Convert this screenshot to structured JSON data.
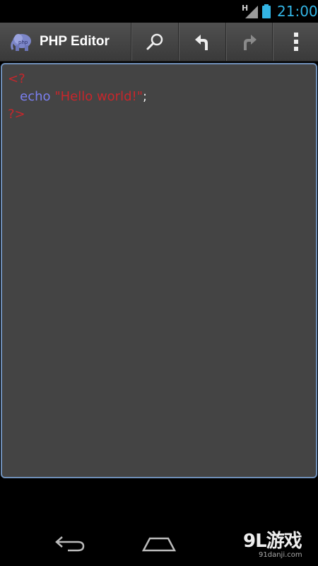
{
  "status_bar": {
    "network": "H",
    "time": "21:00",
    "time_color": "#33b5e5"
  },
  "action_bar": {
    "title": "PHP Editor",
    "actions": [
      {
        "icon": "search-icon"
      },
      {
        "icon": "undo-icon"
      },
      {
        "icon": "redo-icon"
      },
      {
        "icon": "overflow-menu-icon"
      }
    ]
  },
  "editor": {
    "border_color": "#6f8fb8",
    "background": "#444444",
    "lines": [
      {
        "tokens": [
          {
            "t": "tag",
            "text": "<?"
          }
        ]
      },
      {
        "tokens": [
          {
            "t": "ws",
            "text": "   "
          },
          {
            "t": "kw",
            "text": "echo"
          },
          {
            "t": "ws",
            "text": " "
          },
          {
            "t": "str",
            "text": "\"Hello world!\""
          },
          {
            "t": "punct",
            "text": ";"
          }
        ]
      },
      {
        "tokens": [
          {
            "t": "tag",
            "text": "?>"
          }
        ]
      }
    ]
  },
  "nav_bar": {
    "buttons": [
      "back-icon",
      "home-icon"
    ]
  },
  "watermark": {
    "brand": "9L游戏",
    "url": "91danji.com"
  }
}
